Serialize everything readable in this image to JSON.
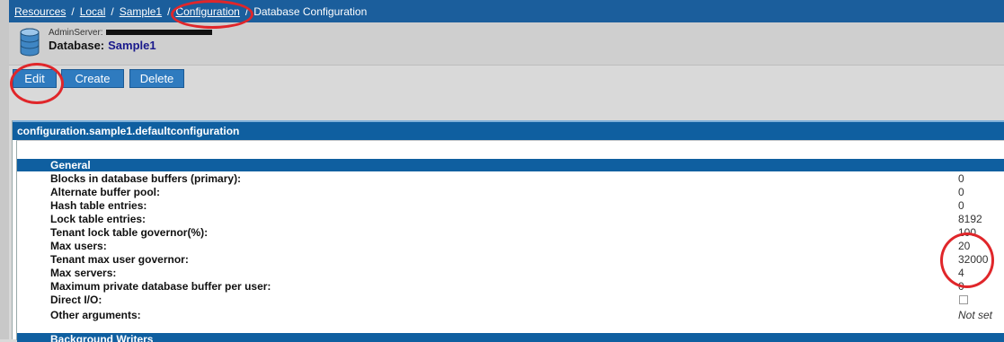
{
  "breadcrumb": {
    "items": [
      "Resources",
      "Local",
      "Sample1",
      "Configuration"
    ],
    "current": "Database Configuration"
  },
  "header": {
    "server_label": "AdminServer:",
    "database_label": "Database:",
    "database_name": "Sample1"
  },
  "toolbar": {
    "edit_label": "Edit",
    "create_label": "Create",
    "delete_label": "Delete"
  },
  "panel": {
    "title": "configuration.sample1.defaultconfiguration",
    "section_general": "General",
    "next_section": "Background Writers",
    "rows": [
      {
        "label": "Blocks in database buffers (primary):",
        "value": "0"
      },
      {
        "label": "Alternate buffer pool:",
        "value": "0"
      },
      {
        "label": "Hash table entries:",
        "value": "0"
      },
      {
        "label": "Lock table entries:",
        "value": "8192"
      },
      {
        "label": "Tenant lock table governor(%):",
        "value": "100"
      },
      {
        "label": "Max users:",
        "value": "20"
      },
      {
        "label": "Tenant max user governor:",
        "value": "32000"
      },
      {
        "label": "Max servers:",
        "value": "4"
      },
      {
        "label": "Maximum private database buffer per user:",
        "value": "0"
      },
      {
        "label": "Direct I/O:",
        "value": ""
      },
      {
        "label": "Other arguments:",
        "value": "Not set"
      }
    ]
  },
  "colors": {
    "bar_blue": "#0f5fa0",
    "annotation_red": "#e0262a"
  }
}
